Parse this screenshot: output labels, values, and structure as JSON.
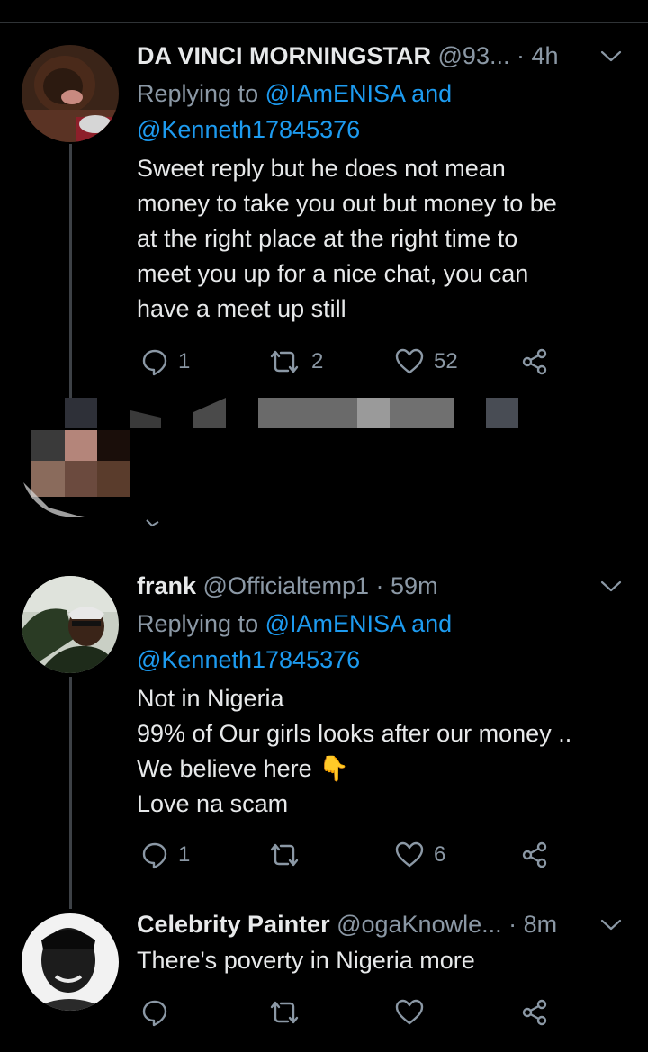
{
  "tweets": [
    {
      "name": "DA VINCI MORNINGSTAR",
      "handle": "@93...",
      "time": "· 4h",
      "replying_prefix": "Replying to",
      "replying_user1": "@IAmENISA",
      "replying_and": "and",
      "replying_user2": "@Kenneth17845376",
      "text_lines": [
        "Sweet reply but he does not mean",
        "money to take you out but money to be",
        "at the right place at the right time to",
        "meet you up for a nice chat, you can",
        "have a meet up still"
      ],
      "replies": "1",
      "retweets": "2",
      "likes": "52"
    },
    {
      "name": "frank",
      "handle": "@Officialtemp1",
      "time": "· 59m",
      "replying_prefix": "Replying to",
      "replying_user1": "@IAmENISA",
      "replying_and": "and",
      "replying_user2": "@Kenneth17845376",
      "text_lines": [
        "Not in Nigeria",
        "99% of Our girls looks after our money ..",
        "We believe here 👇",
        "Love na scam"
      ],
      "replies": "1",
      "retweets": "",
      "likes": "6"
    },
    {
      "name": "Celebrity Painter",
      "handle": "@ogaKnowle...",
      "time": "· 8m",
      "text_lines": [
        "There's poverty in Nigeria more"
      ],
      "replies": "",
      "retweets": "",
      "likes": ""
    }
  ],
  "icons": {
    "reply": "reply-bubble-icon",
    "retweet": "retweet-icon",
    "like": "heart-icon",
    "share": "share-icon",
    "more": "chevron-down-icon"
  },
  "colors": {
    "background": "#000000",
    "text": "#e7e9ea",
    "muted": "#8b98a5",
    "link": "#1d9bf0",
    "divider": "#2f3336"
  }
}
